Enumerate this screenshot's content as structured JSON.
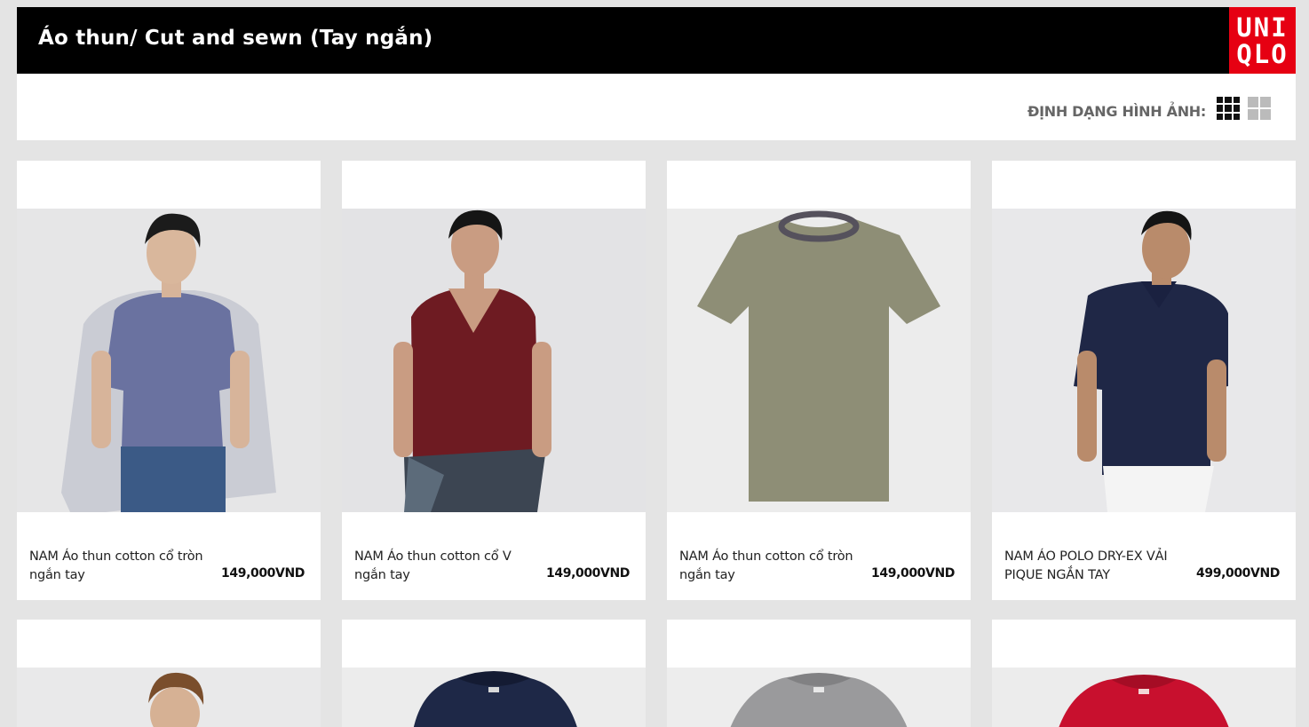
{
  "header": {
    "title": "Áo thun/ Cut and sewn (Tay ngắn)",
    "logo_line1": "UNI",
    "logo_line2": "QLO"
  },
  "toolbar": {
    "view_label": "ĐỊNH DẠNG HÌNH ẢNH:"
  },
  "products": [
    {
      "name": "NAM Áo thun cotton cổ tròn ngắn tay",
      "price": "149,000VND"
    },
    {
      "name": "NAM Áo thun cotton cổ V ngắn tay",
      "price": "149,000VND"
    },
    {
      "name": "NAM Áo thun cotton cổ tròn ngắn tay",
      "price": "149,000VND"
    },
    {
      "name": "NAM ÁO POLO DRY-EX VẢI PIQUE NGẮN TAY",
      "price": "499,000VND"
    }
  ],
  "colors": {
    "brand_red": "#e60012",
    "header_bg": "#000000",
    "page_bg": "#e4e4e4"
  }
}
